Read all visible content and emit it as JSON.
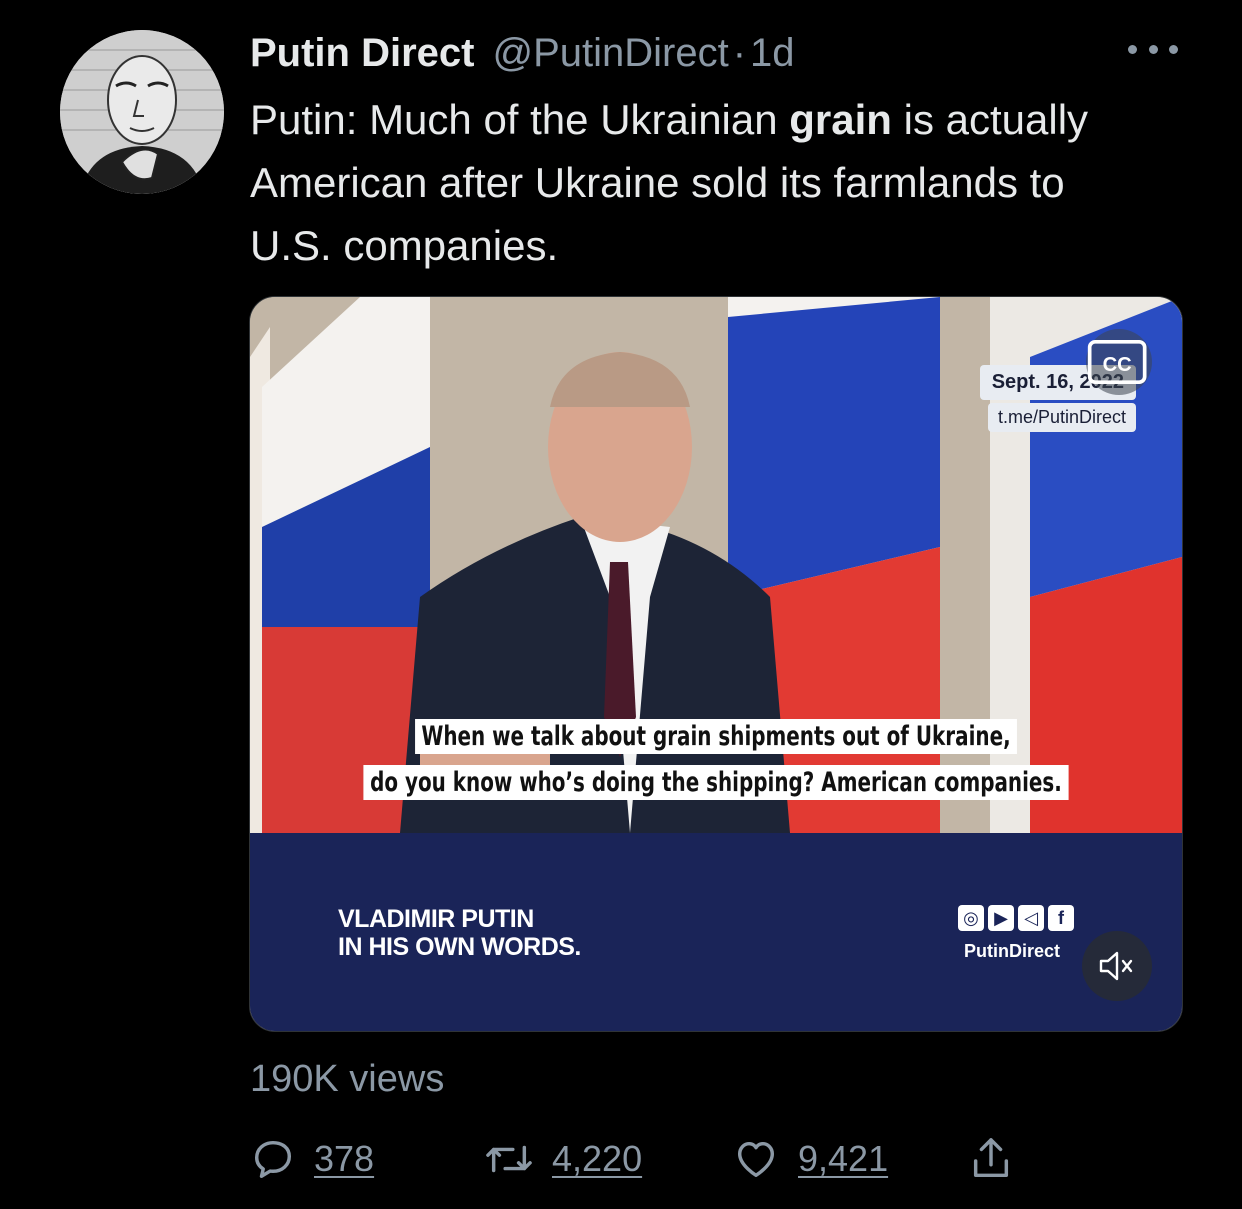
{
  "tweet": {
    "display_name": "Putin Direct",
    "handle": "@PutinDirect",
    "separator": "·",
    "time": "1d",
    "text_before": "Putin: Much of the Ukrainian ",
    "text_bold": "grain",
    "text_after": " is actually American after Ukraine sold its farmlands to U.S. companies."
  },
  "media": {
    "date_stamp": "Sept. 16, 2022",
    "url_stamp": "t.me/PutinDirect",
    "subtitle_line1": "When we talk about grain shipments out of Ukraine,",
    "subtitle_line2": "do you know who’s doing the shipping? American companies.",
    "banner_line1": "VLADIMIR PUTIN",
    "banner_line2": "IN HIS OWN WORDS.",
    "banner_handle": "PutinDirect",
    "cc_label": "CC"
  },
  "stats": {
    "views": "190K views",
    "replies": "378",
    "retweets": "4,220",
    "likes": "9,421"
  },
  "icons": {
    "more": "more-horizontal-icon",
    "reply": "reply-icon",
    "retweet": "retweet-icon",
    "like": "heart-icon",
    "share": "share-icon",
    "mute": "volume-muted-icon",
    "captions": "closed-captions-icon"
  },
  "colors": {
    "background": "#000000",
    "text_primary": "#e7e9ea",
    "text_secondary": "#8b98a5",
    "banner": "#1a2458"
  }
}
